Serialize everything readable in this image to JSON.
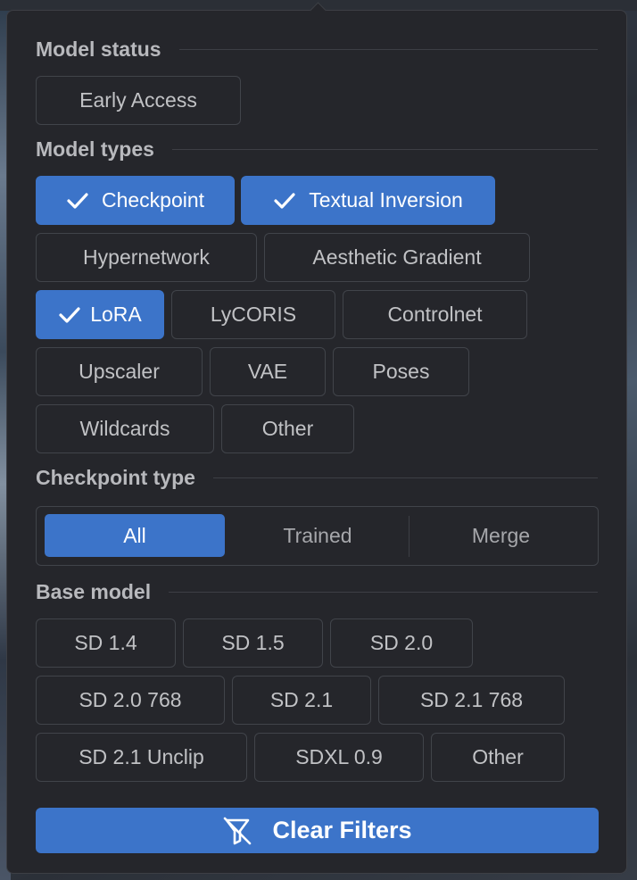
{
  "sections": {
    "model_status": "Model status",
    "model_types": "Model types",
    "checkpoint_type": "Checkpoint type",
    "base_model": "Base model"
  },
  "model_status": [
    "Early Access"
  ],
  "model_types": [
    {
      "label": "Checkpoint",
      "checked": true
    },
    {
      "label": "Textual Inversion",
      "checked": true
    },
    {
      "label": "Hypernetwork",
      "checked": false
    },
    {
      "label": "Aesthetic Gradient",
      "checked": false
    },
    {
      "label": "LoRA",
      "checked": true
    },
    {
      "label": "LyCORIS",
      "checked": false
    },
    {
      "label": "Controlnet",
      "checked": false
    },
    {
      "label": "Upscaler",
      "checked": false
    },
    {
      "label": "VAE",
      "checked": false
    },
    {
      "label": "Poses",
      "checked": false
    },
    {
      "label": "Wildcards",
      "checked": false
    },
    {
      "label": "Other",
      "checked": false
    }
  ],
  "checkpoint_type": {
    "options": [
      "All",
      "Trained",
      "Merge"
    ],
    "selected": "All"
  },
  "base_model": [
    "SD 1.4",
    "SD 1.5",
    "SD 2.0",
    "SD 2.0 768",
    "SD 2.1",
    "SD 2.1 768",
    "SD 2.1 Unclip",
    "SDXL 0.9",
    "Other"
  ],
  "clear_filters": "Clear Filters",
  "colors": {
    "accent": "#3c74c9",
    "panel_bg": "#25262b",
    "border": "#41444a",
    "text": "#c1c2c5"
  },
  "icons": {
    "check": "check-icon",
    "clear": "filter-off-icon"
  }
}
